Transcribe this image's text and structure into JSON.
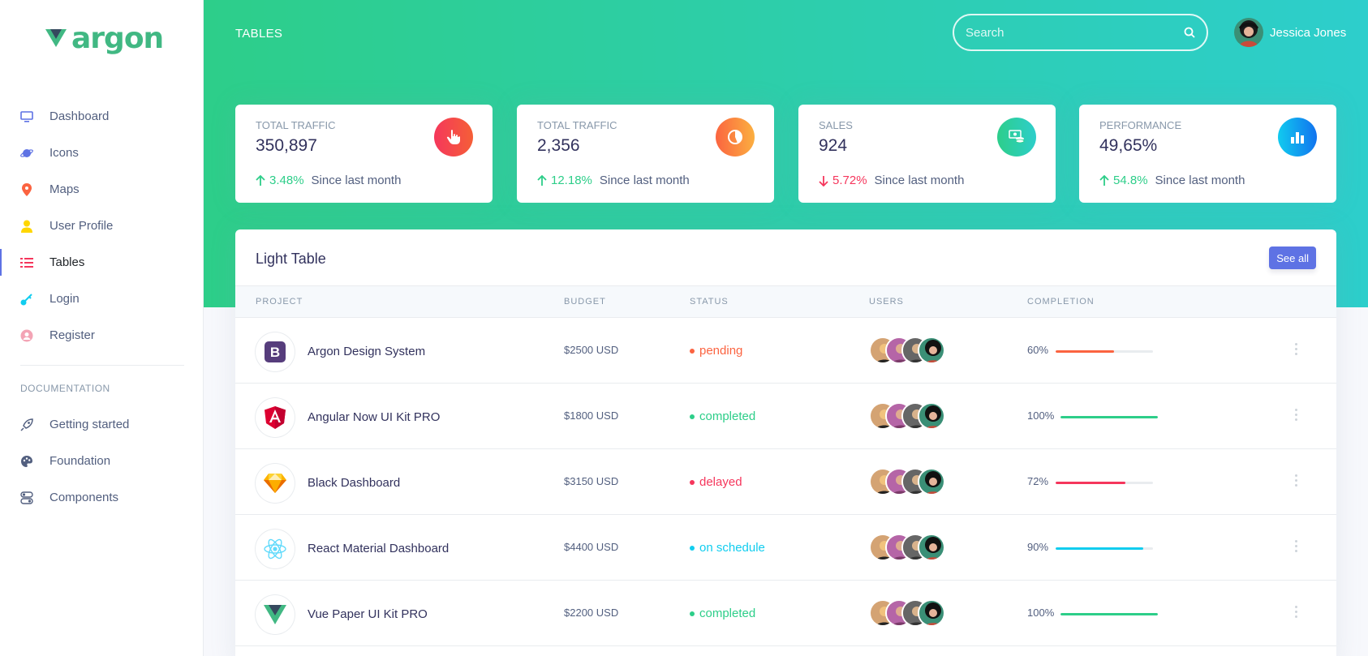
{
  "brand": {
    "name": "argon",
    "color": "#41b883"
  },
  "header": {
    "title": "TABLES",
    "search_placeholder": "Search",
    "user_name": "Jessica Jones",
    "gradient": [
      "#2dce89",
      "#2dcecc"
    ]
  },
  "sidebar": {
    "items": [
      {
        "label": "Dashboard",
        "icon": "monitor-icon",
        "color": "#5e72e4"
      },
      {
        "label": "Icons",
        "icon": "planet-icon",
        "color": "#5e72e4"
      },
      {
        "label": "Maps",
        "icon": "pin-icon",
        "color": "#fb6340"
      },
      {
        "label": "User Profile",
        "icon": "user-icon",
        "color": "#ffd600"
      },
      {
        "label": "Tables",
        "icon": "list-icon",
        "color": "#f5365c",
        "active": true
      },
      {
        "label": "Login",
        "icon": "key-icon",
        "color": "#11cdef"
      },
      {
        "label": "Register",
        "icon": "user-circle-icon",
        "color": "#f3a4b5"
      }
    ],
    "doc_heading": "DOCUMENTATION",
    "doc_items": [
      {
        "label": "Getting started",
        "icon": "rocket-icon"
      },
      {
        "label": "Foundation",
        "icon": "palette-icon"
      },
      {
        "label": "Components",
        "icon": "components-icon"
      }
    ]
  },
  "stats": [
    {
      "label": "Total traffic",
      "value": "350,897",
      "change": "3.48%",
      "direction": "up",
      "since": "Since last month",
      "icon": "pointer-icon",
      "colors": [
        "#f5365c",
        "#f56036"
      ]
    },
    {
      "label": "Total traffic",
      "value": "2,356",
      "change": "12.18%",
      "direction": "up",
      "since": "Since last month",
      "icon": "pie-chart-icon",
      "colors": [
        "#fb6340",
        "#fbb140"
      ]
    },
    {
      "label": "Sales",
      "value": "924",
      "change": "5.72%",
      "direction": "down",
      "since": "Since last month",
      "icon": "money-coins-icon",
      "colors": [
        "#2dce89",
        "#2dcecc"
      ]
    },
    {
      "label": "Performance",
      "value": "49,65%",
      "change": "54.8%",
      "direction": "up",
      "since": "Since last month",
      "icon": "bar-chart-icon",
      "colors": [
        "#11cdef",
        "#1171ef"
      ]
    }
  ],
  "table": {
    "title": "Light Table",
    "see_all": "See all",
    "columns": [
      "Project",
      "Budget",
      "Status",
      "Users",
      "Completion"
    ],
    "rows": [
      {
        "project": "Argon Design System",
        "logo": "bootstrap-icon",
        "budget": "$2500 USD",
        "status": "pending",
        "status_color": "#fb6340",
        "completion": "60%",
        "completion_value": 0.6,
        "bar_color": "#fb6340"
      },
      {
        "project": "Angular Now UI Kit PRO",
        "logo": "angular-icon",
        "budget": "$1800 USD",
        "status": "completed",
        "status_color": "#2dce89",
        "completion": "100%",
        "completion_value": 1.0,
        "bar_color": "#2dce89"
      },
      {
        "project": "Black Dashboard",
        "logo": "sketch-icon",
        "budget": "$3150 USD",
        "status": "delayed",
        "status_color": "#f5365c",
        "completion": "72%",
        "completion_value": 0.72,
        "bar_color": "#f5365c"
      },
      {
        "project": "React Material Dashboard",
        "logo": "react-icon",
        "budget": "$4400 USD",
        "status": "on schedule",
        "status_color": "#11cdef",
        "completion": "90%",
        "completion_value": 0.9,
        "bar_color": "#11cdef"
      },
      {
        "project": "Vue Paper UI Kit PRO",
        "logo": "vue-icon",
        "budget": "$2200 USD",
        "status": "completed",
        "status_color": "#2dce89",
        "completion": "100%",
        "completion_value": 1.0,
        "bar_color": "#2dce89"
      }
    ]
  }
}
